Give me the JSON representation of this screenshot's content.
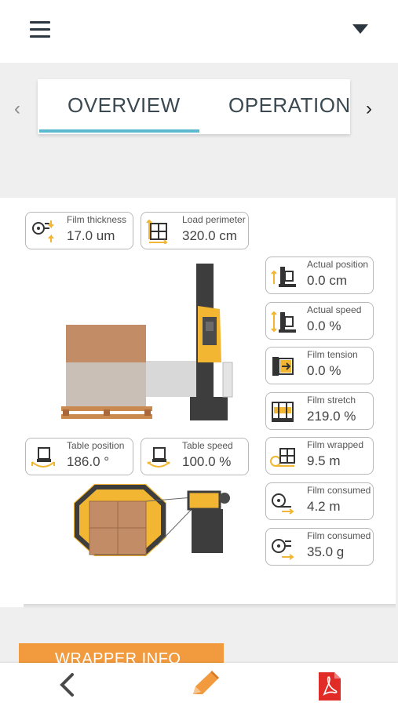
{
  "tabs": {
    "items": [
      {
        "label": "OVERVIEW",
        "active": true
      },
      {
        "label": "OPERATIONAL",
        "active": false
      }
    ],
    "prev_arrow": "‹",
    "next_arrow": "›"
  },
  "metrics_top": [
    {
      "label": "Film thickness",
      "value": "17.0 um",
      "icon": "film-thickness-icon"
    },
    {
      "label": "Load perimeter",
      "value": "320.0 cm",
      "icon": "load-perimeter-icon"
    }
  ],
  "metrics_mid": [
    {
      "label": "Table position",
      "value": "186.0 °",
      "icon": "table-position-icon"
    },
    {
      "label": "Table speed",
      "value": "100.0 %",
      "icon": "table-speed-icon"
    }
  ],
  "metrics_right": [
    {
      "label": "Actual position",
      "value": "0.0 cm",
      "icon": "actual-position-icon"
    },
    {
      "label": "Actual speed",
      "value": "0.0 %",
      "icon": "actual-speed-icon"
    },
    {
      "label": "Film tension",
      "value": "0.0 %",
      "icon": "film-tension-icon"
    },
    {
      "label": "Film stretch",
      "value": "219.0 %",
      "icon": "film-stretch-icon"
    },
    {
      "label": "Film wrapped",
      "value": "9.5 m",
      "icon": "film-wrapped-icon"
    },
    {
      "label": "Film consumed",
      "value": "4.2 m",
      "icon": "film-consumed-length-icon"
    },
    {
      "label": "Film consumed",
      "value": "35.0 g",
      "icon": "film-consumed-weight-icon"
    }
  ],
  "wrapper_info_button": "WRAPPER INFO",
  "colors": {
    "accent_yellow": "#f2b632",
    "machine_dark": "#3d3d3d",
    "tab_underline": "#5bb9d0",
    "button_orange": "#f19a3e",
    "pdf_red": "#e02b27"
  },
  "bottom_nav": {
    "back_icon": "back-chevron-icon",
    "edit_icon": "pencil-icon",
    "pdf_icon": "pdf-icon"
  }
}
